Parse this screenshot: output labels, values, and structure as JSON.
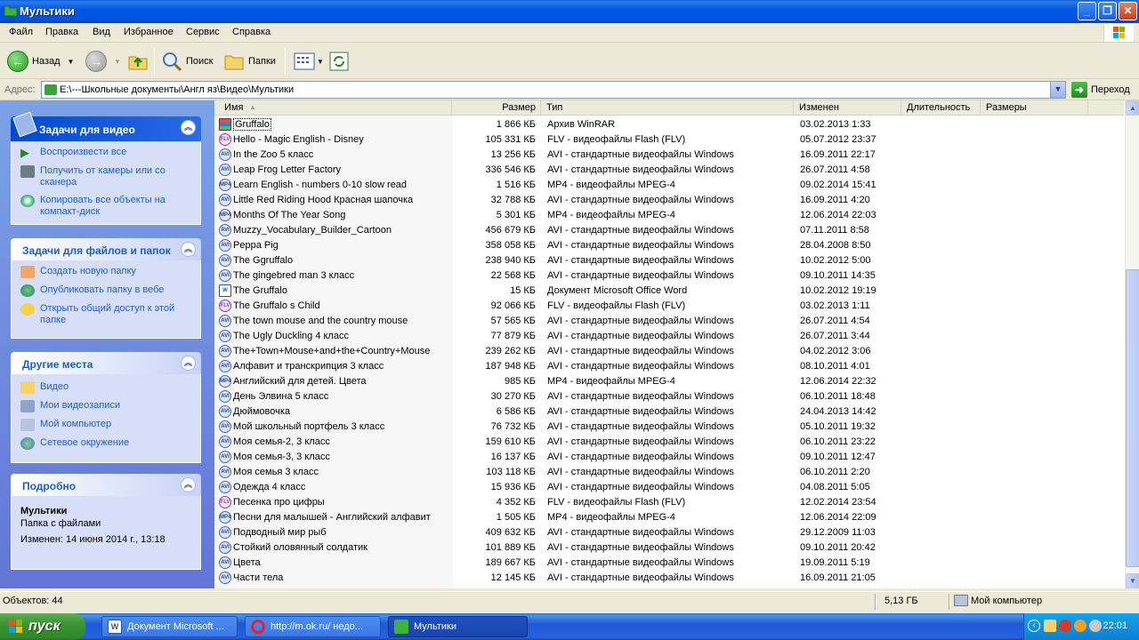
{
  "window": {
    "title": "Мультики"
  },
  "menu": [
    "Файл",
    "Правка",
    "Вид",
    "Избранное",
    "Сервис",
    "Справка"
  ],
  "toolbar": {
    "back": "Назад",
    "search": "Поиск",
    "folders": "Папки"
  },
  "address": {
    "label": "Адрес:",
    "path": "E:\\---Школьные документы\\Англ яз\\Видео\\Мультики",
    "go": "Переход"
  },
  "left_panels": {
    "video_tasks": {
      "title": "Задачи для видео",
      "items": [
        "Воспроизвести все",
        "Получить от камеры или со сканера",
        "Копировать все объекты на компакт-диск"
      ]
    },
    "file_tasks": {
      "title": "Задачи для файлов и папок",
      "items": [
        "Создать новую папку",
        "Опубликовать папку в вебе",
        "Открыть общий доступ к этой папке"
      ]
    },
    "other_places": {
      "title": "Другие места",
      "items": [
        "Видео",
        "Мои видеозаписи",
        "Мой компьютер",
        "Сетевое окружение"
      ]
    },
    "details": {
      "title": "Подробно",
      "name": "Мультики",
      "kind": "Папка с файлами",
      "modified": "Изменен: 14 июня 2014 г., 13:18"
    }
  },
  "columns": [
    "Имя",
    "Размер",
    "Тип",
    "Изменен",
    "Длительность",
    "Размеры"
  ],
  "files": [
    {
      "name": "Gruffalo",
      "size": "1 866 КБ",
      "type": "Архив WinRAR",
      "date": "03.02.2013 1:33",
      "icon": "rar"
    },
    {
      "name": "Hello - Magic English - Disney",
      "size": "105 331 КБ",
      "type": "FLV - видеофайлы Flash (FLV)",
      "date": "05.07.2012 23:37",
      "icon": "flv"
    },
    {
      "name": "In the Zoo 5 класс",
      "size": "13 256 КБ",
      "type": "AVI - стандартные видеофайлы Windows",
      "date": "16.09.2011 22:17",
      "icon": "avi"
    },
    {
      "name": "Leap Frog Letter Factory",
      "size": "336 546 КБ",
      "type": "AVI - стандартные видеофайлы Windows",
      "date": "26.07.2011 4:58",
      "icon": "avi"
    },
    {
      "name": "Learn English - numbers 0-10 slow read",
      "size": "1 516 КБ",
      "type": "MP4 - видеофайлы MPEG-4",
      "date": "09.02.2014 15:41",
      "icon": "mp4"
    },
    {
      "name": "Little Red Riding Hood Красная шапочка",
      "size": "32 788 КБ",
      "type": "AVI - стандартные видеофайлы Windows",
      "date": "16.09.2011 4:20",
      "icon": "avi"
    },
    {
      "name": "Months Of The Year Song",
      "size": "5 301 КБ",
      "type": "MP4 - видеофайлы MPEG-4",
      "date": "12.06.2014 22:03",
      "icon": "mp4"
    },
    {
      "name": "Muzzy_Vocabulary_Builder_Cartoon",
      "size": "456 679 КБ",
      "type": "AVI - стандартные видеофайлы Windows",
      "date": "07.11.2011 8:58",
      "icon": "avi"
    },
    {
      "name": "Peppa Pig",
      "size": "358 058 КБ",
      "type": "AVI - стандартные видеофайлы Windows",
      "date": "28.04.2008 8:50",
      "icon": "avi"
    },
    {
      "name": "The Ggruffalo",
      "size": "238 940 КБ",
      "type": "AVI - стандартные видеофайлы Windows",
      "date": "10.02.2012 5:00",
      "icon": "avi"
    },
    {
      "name": "The gingebred man 3 класс",
      "size": "22 568 КБ",
      "type": "AVI - стандартные видеофайлы Windows",
      "date": "09.10.2011 14:35",
      "icon": "avi"
    },
    {
      "name": "The Gruffalo",
      "size": "15 КБ",
      "type": "Документ Microsoft Office Word",
      "date": "10.02.2012 19:19",
      "icon": "doc"
    },
    {
      "name": "The Gruffalo s Child",
      "size": "92 066 КБ",
      "type": "FLV - видеофайлы Flash (FLV)",
      "date": "03.02.2013 1:11",
      "icon": "flv"
    },
    {
      "name": "The town mouse and the country mouse",
      "size": "57 565 КБ",
      "type": "AVI - стандартные видеофайлы Windows",
      "date": "26.07.2011 4:54",
      "icon": "avi"
    },
    {
      "name": "The Ugly Duckling 4 класс",
      "size": "77 879 КБ",
      "type": "AVI - стандартные видеофайлы Windows",
      "date": "26.07.2011 3:44",
      "icon": "avi"
    },
    {
      "name": "The+Town+Mouse+and+the+Country+Mouse",
      "size": "239 262 КБ",
      "type": "AVI - стандартные видеофайлы Windows",
      "date": "04.02.2012 3:06",
      "icon": "avi"
    },
    {
      "name": "Алфавит и транскрипция 3 класс",
      "size": "187 948 КБ",
      "type": "AVI - стандартные видеофайлы Windows",
      "date": "08.10.2011 4:01",
      "icon": "avi"
    },
    {
      "name": "Английский для детей. Цвета",
      "size": "985 КБ",
      "type": "MP4 - видеофайлы MPEG-4",
      "date": "12.06.2014 22:32",
      "icon": "mp4"
    },
    {
      "name": "День Элвина 5 класс",
      "size": "30 270 КБ",
      "type": "AVI - стандартные видеофайлы Windows",
      "date": "06.10.2011 18:48",
      "icon": "avi"
    },
    {
      "name": "Дюймовочка",
      "size": "6 586 КБ",
      "type": "AVI - стандартные видеофайлы Windows",
      "date": "24.04.2013 14:42",
      "icon": "avi"
    },
    {
      "name": "Мой школьный портфель 3 класс",
      "size": "76 732 КБ",
      "type": "AVI - стандартные видеофайлы Windows",
      "date": "05.10.2011 19:32",
      "icon": "avi"
    },
    {
      "name": "Моя семья-2, 3 класс",
      "size": "159 610 КБ",
      "type": "AVI - стандартные видеофайлы Windows",
      "date": "06.10.2011 23:22",
      "icon": "avi"
    },
    {
      "name": "Моя семья-3, 3 класс",
      "size": "16 137 КБ",
      "type": "AVI - стандартные видеофайлы Windows",
      "date": "09.10.2011 12:47",
      "icon": "avi"
    },
    {
      "name": "Моя семья 3 класс",
      "size": "103 118 КБ",
      "type": "AVI - стандартные видеофайлы Windows",
      "date": "06.10.2011 2:20",
      "icon": "avi"
    },
    {
      "name": "Одежда 4 класс",
      "size": "15 936 КБ",
      "type": "AVI - стандартные видеофайлы Windows",
      "date": "04.08.2011 5:05",
      "icon": "avi"
    },
    {
      "name": "Песенка про цифры",
      "size": "4 352 КБ",
      "type": "FLV - видеофайлы Flash (FLV)",
      "date": "12.02.2014 23:54",
      "icon": "flv"
    },
    {
      "name": "Песни для малышей - Английский алфавит",
      "size": "1 505 КБ",
      "type": "MP4 - видеофайлы MPEG-4",
      "date": "12.06.2014 22:09",
      "icon": "mp4"
    },
    {
      "name": "Подводный мир рыб",
      "size": "409 632 КБ",
      "type": "AVI - стандартные видеофайлы Windows",
      "date": "29.12.2009 11:03",
      "icon": "avi"
    },
    {
      "name": "Стойкий оловянный солдатик",
      "size": "101 889 КБ",
      "type": "AVI - стандартные видеофайлы Windows",
      "date": "09.10.2011 20:42",
      "icon": "avi"
    },
    {
      "name": "Цвета",
      "size": "189 667 КБ",
      "type": "AVI - стандартные видеофайлы Windows",
      "date": "19.09.2011 5:19",
      "icon": "avi"
    },
    {
      "name": "Части тела",
      "size": "12 145 КБ",
      "type": "AVI - стандартные видеофайлы Windows",
      "date": "16.09.2011 21:05",
      "icon": "avi"
    }
  ],
  "status": {
    "objects": "Объектов: 44",
    "size": "5,13 ГБ",
    "location": "Мой компьютер"
  },
  "taskbar": {
    "start": "пуск",
    "items": [
      "Документ Microsoft ...",
      "http://m.ok.ru/ недо...",
      "Мультики"
    ],
    "clock": "22:01"
  }
}
